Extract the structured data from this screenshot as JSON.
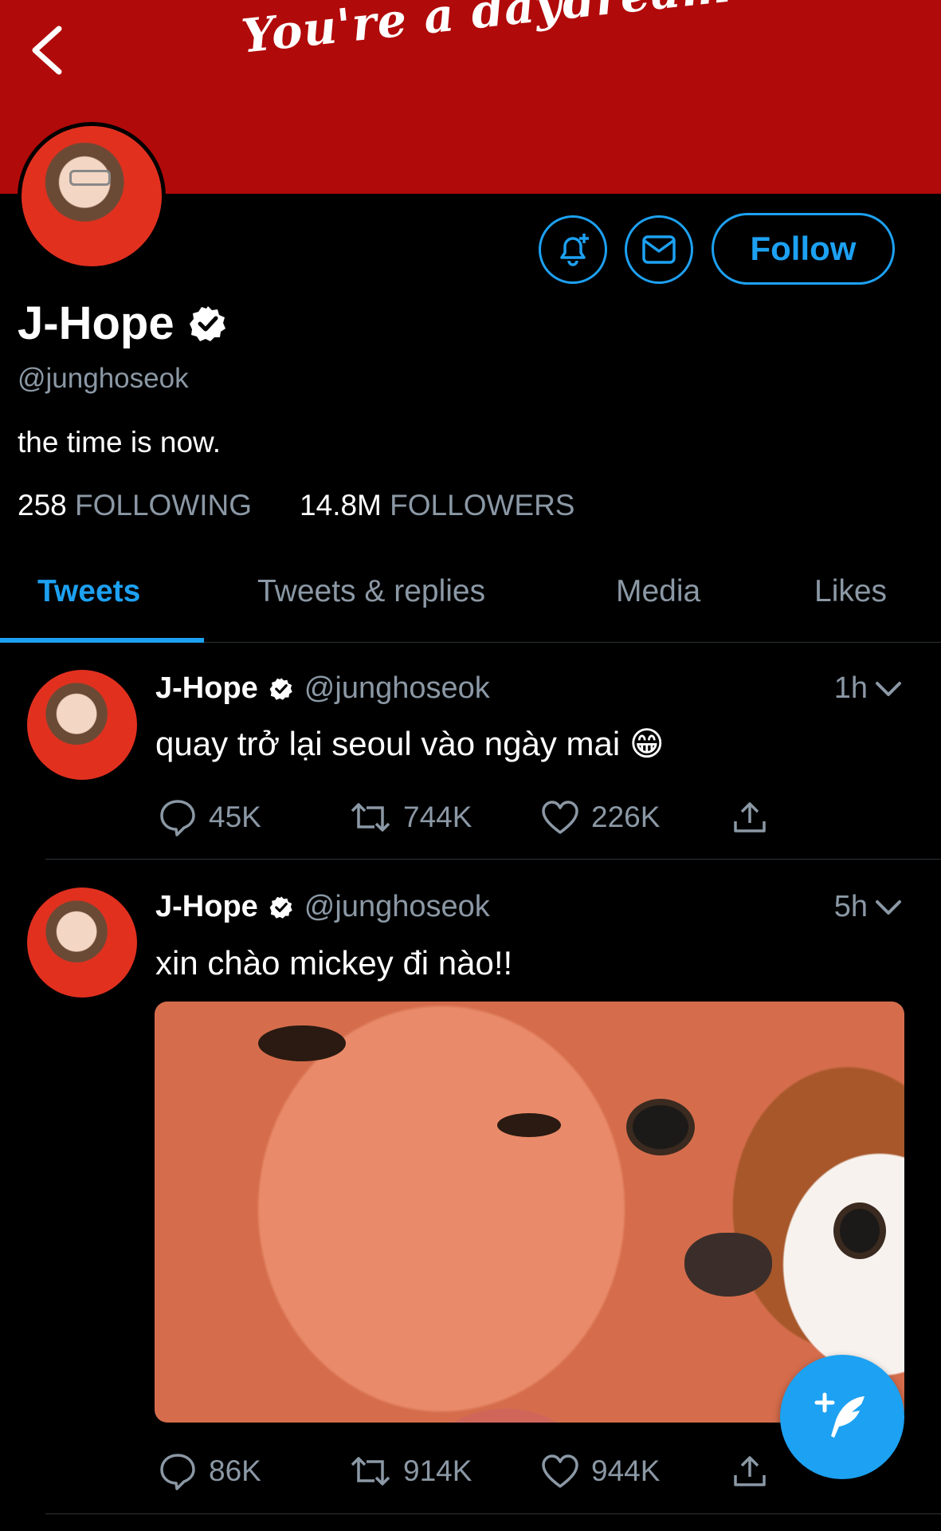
{
  "banner": {
    "text": "You're a daydream"
  },
  "profile": {
    "name": "J-Hope",
    "handle": "@junghoseok",
    "bio": "the time is now.",
    "following_count": "258",
    "following_label": "FOLLOWING",
    "followers_count": "14.8M",
    "followers_label": "FOLLOWERS"
  },
  "actions": {
    "follow_label": "Follow"
  },
  "tabs": [
    {
      "label": "Tweets",
      "active": true
    },
    {
      "label": "Tweets & replies",
      "active": false
    },
    {
      "label": "Media",
      "active": false
    },
    {
      "label": "Likes",
      "active": false
    }
  ],
  "tweets": [
    {
      "name": "J-Hope",
      "handle": "@junghoseok",
      "time": "1h",
      "text": "quay trở lại seoul vào ngày mai 😁",
      "replies": "45K",
      "retweets": "744K",
      "likes": "226K"
    },
    {
      "name": "J-Hope",
      "handle": "@junghoseok",
      "time": "5h",
      "text": "xin chào mickey đi nào!!",
      "replies": "86K",
      "retweets": "914K",
      "likes": "944K"
    }
  ],
  "colors": {
    "accent": "#1da1f2",
    "banner": "#b10a0a",
    "muted": "#8b98a5"
  }
}
